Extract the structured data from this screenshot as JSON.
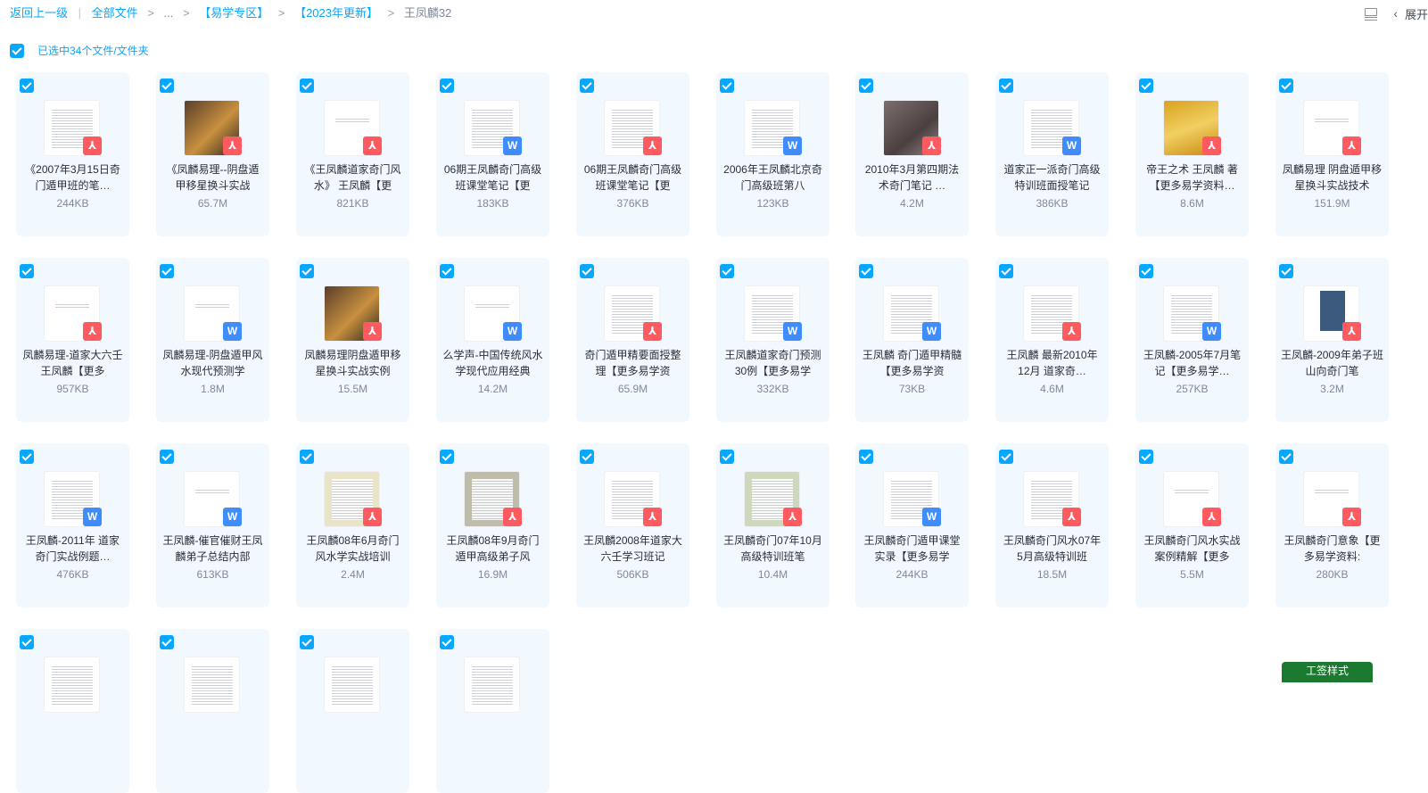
{
  "breadcrumb": {
    "back": "返回上一级",
    "sep": "|",
    "all_files": "全部文件",
    "arrow": ">",
    "ellipsis": "...",
    "folder1": "【易学专区】",
    "folder2": "【2023年更新】",
    "current": "王凤麟32"
  },
  "toolbar": {
    "collapse_label": "展开",
    "collapse_chevron": "‹",
    "list_view_icon": "list-view-icon"
  },
  "selection": {
    "label": "已选中34个文件/文件夹",
    "all_selected": true
  },
  "files": [
    {
      "name": "《2007年3月15日奇门遁甲班的笔…",
      "size": "244KB",
      "type": "pdf",
      "thumb": "doc"
    },
    {
      "name": "《凤麟易理--阴盘遁甲移星换斗实战",
      "size": "65.7M",
      "type": "pdf",
      "thumb": "photo"
    },
    {
      "name": "《王凤麟道家奇门风水》 王凤麟【更",
      "size": "821KB",
      "type": "pdf",
      "thumb": "sparse"
    },
    {
      "name": "06期王凤麟奇门高级班课堂笔记【更",
      "size": "183KB",
      "type": "doc",
      "thumb": "doc"
    },
    {
      "name": "06期王凤麟奇门高级班课堂笔记【更",
      "size": "376KB",
      "type": "pdf",
      "thumb": "doc"
    },
    {
      "name": "2006年王凤麟北京奇门高级班第八",
      "size": "123KB",
      "type": "doc",
      "thumb": "doc"
    },
    {
      "name": "2010年3月第四期法术奇门笔记 …",
      "size": "4.2M",
      "type": "pdf",
      "thumb": "dark"
    },
    {
      "name": "道家正一派奇门高级特训班面授笔记",
      "size": "386KB",
      "type": "doc",
      "thumb": "doc"
    },
    {
      "name": "帝王之术 王凤麟 著【更多易学资料…",
      "size": "8.6M",
      "type": "pdf",
      "thumb": "gold"
    },
    {
      "name": "凤麟易理 阴盘遁甲移星换斗实战技术",
      "size": "151.9M",
      "type": "pdf",
      "thumb": "sparse"
    },
    {
      "name": "凤麟易理-道家大六壬 王凤麟【更多",
      "size": "957KB",
      "type": "pdf",
      "thumb": "sparse"
    },
    {
      "name": "凤麟易理-阴盘遁甲风水现代预测学",
      "size": "1.8M",
      "type": "doc",
      "thumb": "sparse"
    },
    {
      "name": "凤麟易理阴盘遁甲移星换斗实战实例",
      "size": "15.5M",
      "type": "pdf",
      "thumb": "photo"
    },
    {
      "name": "么学声-中国传统风水学现代应用经典",
      "size": "14.2M",
      "type": "doc",
      "thumb": "sparse"
    },
    {
      "name": "奇门遁甲精要面授整理【更多易学资",
      "size": "65.9M",
      "type": "pdf",
      "thumb": "doc"
    },
    {
      "name": "王凤麟道家奇门预测30例【更多易学",
      "size": "332KB",
      "type": "doc",
      "thumb": "doc"
    },
    {
      "name": "王凤麟 奇门遁甲精髓【更多易学资",
      "size": "73KB",
      "type": "doc",
      "thumb": "doc"
    },
    {
      "name": "王凤麟 最新2010年12月 道家奇…",
      "size": "4.6M",
      "type": "pdf",
      "thumb": "doc"
    },
    {
      "name": "王凤麟-2005年7月笔记【更多易学…",
      "size": "257KB",
      "type": "doc",
      "thumb": "doc"
    },
    {
      "name": "王凤麟-2009年弟子班山向奇门笔",
      "size": "3.2M",
      "type": "pdf",
      "thumb": "blue"
    },
    {
      "name": "王凤麟-2011年 道家奇门实战例题…",
      "size": "476KB",
      "type": "doc",
      "thumb": "doc"
    },
    {
      "name": "王凤麟-催官催财王凤麟弟子总结内部",
      "size": "613KB",
      "type": "doc",
      "thumb": "sparse"
    },
    {
      "name": "王凤麟08年6月奇门风水学实战培训",
      "size": "2.4M",
      "type": "pdf",
      "thumb": "scan"
    },
    {
      "name": "王凤麟08年9月奇门遁甲高级弟子风",
      "size": "16.9M",
      "type": "pdf",
      "thumb": "scan2"
    },
    {
      "name": "王凤麟2008年道家大六壬学习班记",
      "size": "506KB",
      "type": "pdf",
      "thumb": "doc"
    },
    {
      "name": "王凤麟奇门07年10月高级特训班笔",
      "size": "10.4M",
      "type": "pdf",
      "thumb": "scan3"
    },
    {
      "name": "王凤麟奇门遁甲课堂实录【更多易学",
      "size": "244KB",
      "type": "doc",
      "thumb": "doc"
    },
    {
      "name": "王凤麟奇门风水07年5月高级特训班",
      "size": "18.5M",
      "type": "pdf",
      "thumb": "doc"
    },
    {
      "name": "王凤麟奇门风水实战案例精解【更多",
      "size": "5.5M",
      "type": "pdf",
      "thumb": "sparse"
    },
    {
      "name": "王凤麟奇门意象【更多易学资料:",
      "size": "280KB",
      "type": "pdf",
      "thumb": "sparse"
    },
    {
      "name": "",
      "size": "",
      "type": "",
      "thumb": "doc"
    },
    {
      "name": "",
      "size": "",
      "type": "",
      "thumb": "doc"
    },
    {
      "name": "",
      "size": "",
      "type": "",
      "thumb": "doc"
    },
    {
      "name": "",
      "size": "",
      "type": "",
      "thumb": "doc"
    }
  ],
  "badges": {
    "pdf": "⅄",
    "doc": "W"
  },
  "bottom_button": "工签样式",
  "colors": {
    "accent": "#06a7ff",
    "card_bg": "#f1f9ff",
    "pdf": "#ff5a5f",
    "doc": "#3f8cff"
  }
}
